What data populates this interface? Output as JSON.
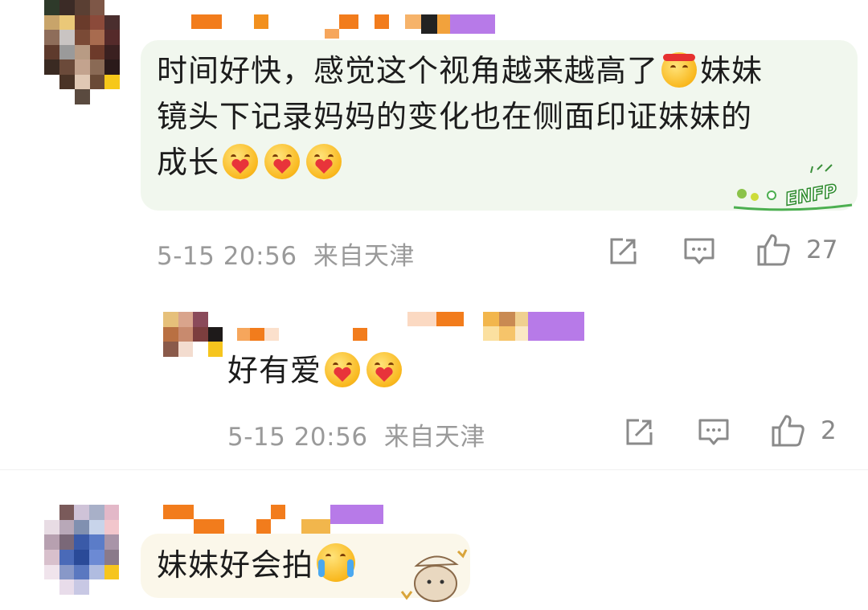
{
  "comments": [
    {
      "text_line1": "时间好快，感觉这个视角越来越高了",
      "text_line1_tail": "妹妹",
      "text_line2": "镜头下记录妈妈的变化也在侧面印证妹妹的",
      "text_line3": "成长",
      "time": "5-15 20:56",
      "location": "来自天津",
      "likes": "27",
      "bubble_badge": "ENFP"
    },
    {
      "text": "好有爱",
      "time": "5-15 20:56",
      "location": "来自天津",
      "likes": "2"
    },
    {
      "text": "妹妹好会拍"
    }
  ],
  "icons": {
    "share": "share-icon",
    "comment": "comment-icon",
    "like": "thumbs-up-icon"
  },
  "colors": {
    "bubble_green": "#f1f7ee",
    "bubble_yellow": "#fbf7ea",
    "meta_gray": "#9a9a9a",
    "nick_orange": "#f27c1c",
    "badge_purple": "#b77ae8"
  }
}
